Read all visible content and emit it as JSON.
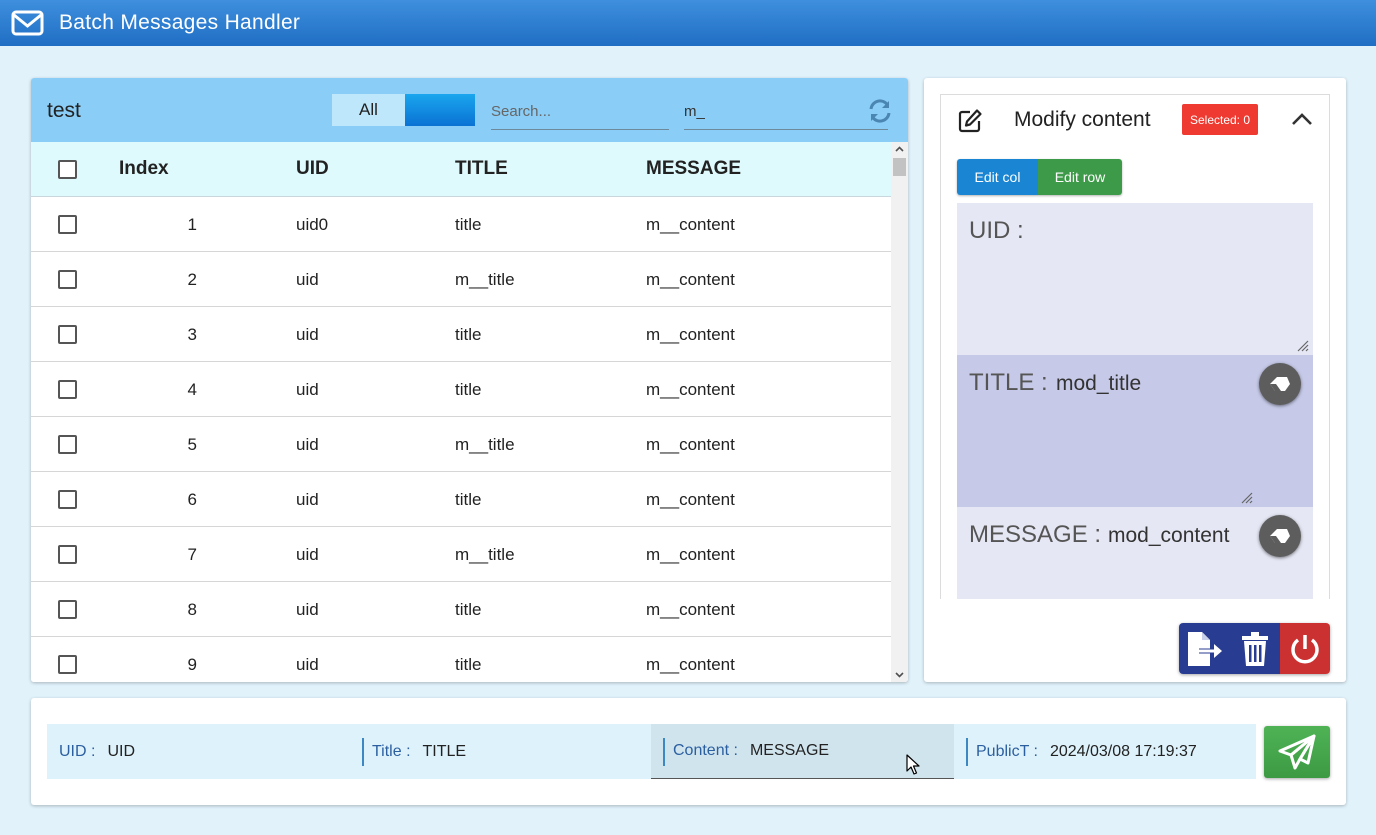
{
  "app": {
    "title": "Batch Messages Handler"
  },
  "table_panel": {
    "title": "test",
    "filter": {
      "all_label": "All"
    },
    "search": {
      "placeholder": "Search...",
      "value": ""
    },
    "filter_input": {
      "value": "m_"
    },
    "columns": [
      "Index",
      "UID",
      "TITLE",
      "MESSAGE"
    ],
    "rows": [
      {
        "index": "1",
        "uid": "uid0",
        "title": "title",
        "message": "m__content"
      },
      {
        "index": "2",
        "uid": "uid",
        "title": "m__title",
        "message": "m__content"
      },
      {
        "index": "3",
        "uid": "uid",
        "title": "title",
        "message": "m__content"
      },
      {
        "index": "4",
        "uid": "uid",
        "title": "title",
        "message": "m__content"
      },
      {
        "index": "5",
        "uid": "uid",
        "title": "m__title",
        "message": "m__content"
      },
      {
        "index": "6",
        "uid": "uid",
        "title": "title",
        "message": "m__content"
      },
      {
        "index": "7",
        "uid": "uid",
        "title": "m__title",
        "message": "m__content"
      },
      {
        "index": "8",
        "uid": "uid",
        "title": "title",
        "message": "m__content"
      },
      {
        "index": "9",
        "uid": "uid",
        "title": "title",
        "message": "m__content"
      }
    ]
  },
  "modify_panel": {
    "title": "Modify content",
    "selected_badge": "Selected: 0",
    "tabs": {
      "edit_col": "Edit col",
      "edit_row": "Edit row"
    },
    "fields": {
      "uid": {
        "label": "UID :",
        "value": ""
      },
      "title": {
        "label": "TITLE :",
        "value": "mod_title"
      },
      "message": {
        "label": "MESSAGE :",
        "value": "mod_content"
      }
    }
  },
  "compose": {
    "uid": {
      "label": "UID :",
      "value": "UID"
    },
    "title": {
      "label": "Title :",
      "value": "TITLE"
    },
    "content": {
      "label": "Content :",
      "value": "MESSAGE"
    },
    "public_time": {
      "label": "PublicT :",
      "value": "2024/03/08 17:19:37"
    }
  },
  "icons": {
    "app": "envelope-icon",
    "refresh": "refresh-icon",
    "edit": "edit-icon",
    "collapse": "chevron-up-icon",
    "erase": "eraser-icon",
    "export": "file-export-icon",
    "delete": "trash-icon",
    "power": "power-icon",
    "send": "paper-plane-icon"
  },
  "colors": {
    "header_bar": "#2a7bd0",
    "table_header": "#8acdf6",
    "badge": "#ee3a30",
    "edit_col": "#1a86d3",
    "edit_row": "#3d9a48",
    "send": "#46a84d",
    "power": "#cc3131",
    "action_blue": "#283d92"
  }
}
